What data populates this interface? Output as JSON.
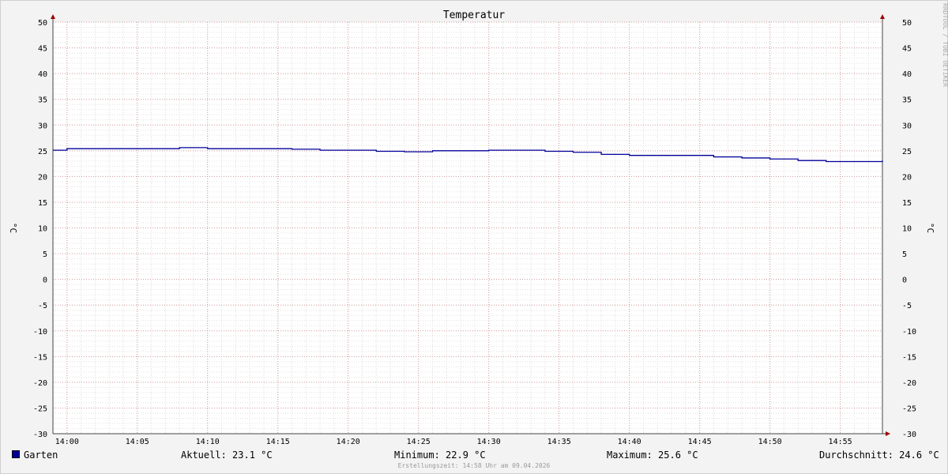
{
  "chart_data": {
    "type": "line",
    "title": "Temperatur",
    "ylabel": "°C",
    "ylabel_right": "°C",
    "ylim": [
      -30,
      50
    ],
    "yticks": [
      50,
      45,
      40,
      35,
      30,
      25,
      20,
      15,
      10,
      5,
      0,
      -5,
      -10,
      -15,
      -20,
      -25,
      -30
    ],
    "xlim": [
      "13:59",
      "14:58"
    ],
    "xticks": [
      "14:00",
      "14:05",
      "14:10",
      "14:15",
      "14:20",
      "14:25",
      "14:30",
      "14:35",
      "14:40",
      "14:45",
      "14:50",
      "14:55"
    ],
    "grid": true,
    "legend_position": "bottom-left",
    "series": [
      {
        "name": "Garten",
        "color": "#00009c",
        "step": true,
        "x": [
          "13:58",
          "14:00",
          "14:02",
          "14:04",
          "14:06",
          "14:08",
          "14:10",
          "14:12",
          "14:14",
          "14:16",
          "14:18",
          "14:20",
          "14:22",
          "14:24",
          "14:26",
          "14:28",
          "14:30",
          "14:32",
          "14:34",
          "14:36",
          "14:38",
          "14:40",
          "14:42",
          "14:44",
          "14:46",
          "14:48",
          "14:50",
          "14:52",
          "14:54",
          "14:56",
          "14:58"
        ],
        "values": [
          25.1,
          25.4,
          25.4,
          25.4,
          25.4,
          25.6,
          25.4,
          25.4,
          25.4,
          25.3,
          25.1,
          25.1,
          24.9,
          24.8,
          25.0,
          25.0,
          25.1,
          25.1,
          24.9,
          24.7,
          24.3,
          24.1,
          24.1,
          24.1,
          23.8,
          23.6,
          23.4,
          23.1,
          22.9,
          22.9,
          23.1
        ]
      }
    ]
  },
  "legend": {
    "series_name": "Garten",
    "swatch_color": "#00009c"
  },
  "stats": {
    "current": "Aktuell: 23.1 °C",
    "minimum": "Minimum: 22.9 °C",
    "maximum": "Maximum: 25.6 °C",
    "average": "Durchschnitt: 24.6 °C"
  },
  "footer": "Erstellungszeit: 14:58 Uhr am 09.04.2026",
  "watermark": "RRDTOOL / TOBI OETIKER"
}
